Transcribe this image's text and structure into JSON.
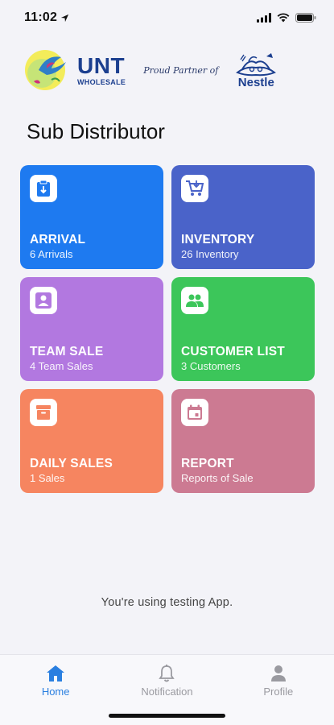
{
  "status_bar": {
    "time": "11:02",
    "icons": [
      "location-arrow-icon",
      "signal-icon",
      "wifi-icon",
      "battery-icon"
    ]
  },
  "header": {
    "brand_main": "UNT",
    "brand_sub": "WHOLESALE",
    "partner_text": "Proud Partner of",
    "partner_brand": "Nestle"
  },
  "page": {
    "title": "Sub Distributor"
  },
  "tiles": [
    {
      "title": "ARRIVAL",
      "subtitle": "6 Arrivals",
      "color": "#1e7af0",
      "icon": "clipboard-icon"
    },
    {
      "title": "INVENTORY",
      "subtitle": "26 Inventory",
      "color": "#4a63c9",
      "icon": "cart-icon"
    },
    {
      "title": "TEAM SALE",
      "subtitle": "4 Team Sales",
      "color": "#b278e0",
      "icon": "person-icon"
    },
    {
      "title": "CUSTOMER LIST",
      "subtitle": "3 Customers",
      "color": "#3cc65a",
      "icon": "group-icon"
    },
    {
      "title": "DAILY SALES",
      "subtitle": "1 Sales",
      "color": "#f68560",
      "icon": "archive-icon"
    },
    {
      "title": "REPORT",
      "subtitle": "Reports of Sale",
      "color": "#cc7a92",
      "icon": "calendar-icon"
    }
  ],
  "footer_note": "You're using testing App.",
  "tab_bar": {
    "items": [
      {
        "label": "Home",
        "icon": "home-icon",
        "active": true
      },
      {
        "label": "Notification",
        "icon": "bell-icon",
        "active": false
      },
      {
        "label": "Profile",
        "icon": "profile-icon",
        "active": false
      }
    ],
    "active_color": "#2a7fe0",
    "inactive_color": "#9a9aa0"
  }
}
